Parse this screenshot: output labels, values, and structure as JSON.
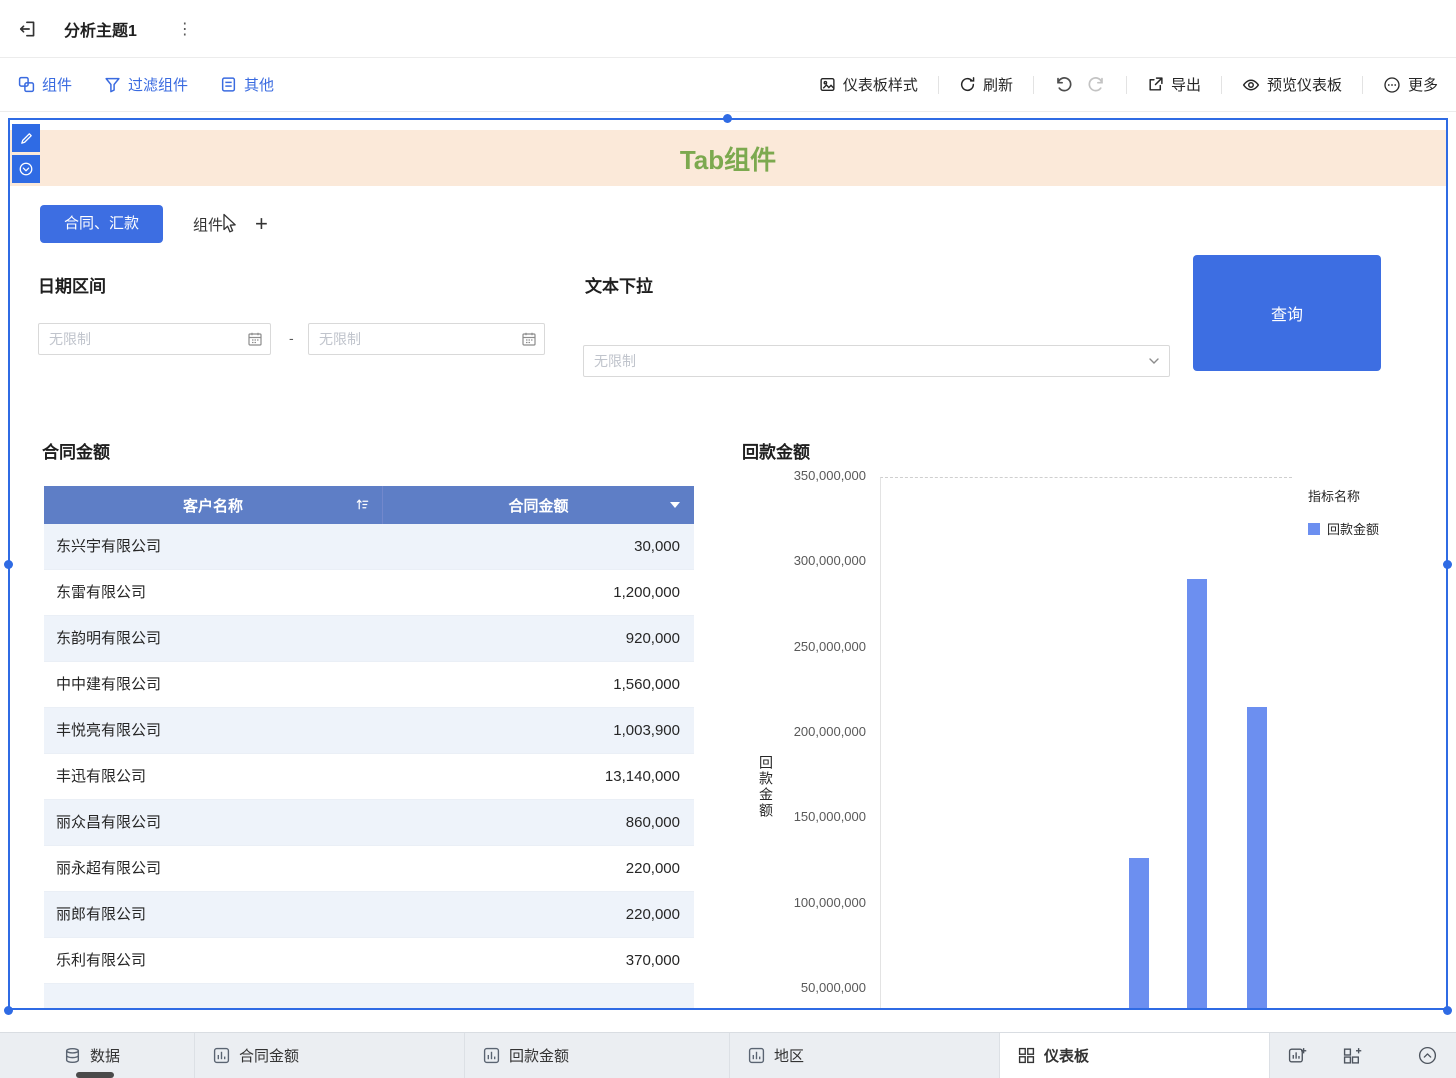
{
  "header": {
    "title": "分析主题1",
    "menu_dots": "⋮"
  },
  "toolbar": {
    "components": "组件",
    "filter_components": "过滤组件",
    "others": "其他",
    "dashboard_style": "仪表板样式",
    "refresh": "刷新",
    "export": "导出",
    "preview": "预览仪表板",
    "more": "更多"
  },
  "canvas": {
    "banner_title": "Tab组件",
    "tabs": {
      "active": "合同、汇款",
      "second": "组件",
      "add": "+"
    },
    "filters": {
      "date_label": "日期区间",
      "date_from_placeholder": "无限制",
      "date_to_placeholder": "无限制",
      "range_separator": "-",
      "select_label": "文本下拉",
      "select_placeholder": "无限制",
      "query_button": "查询"
    },
    "table": {
      "title": "合同金额",
      "columns": [
        "客户名称",
        "合同金额"
      ],
      "rows": [
        [
          "东兴宇有限公司",
          "30,000"
        ],
        [
          "东雷有限公司",
          "1,200,000"
        ],
        [
          "东韵明有限公司",
          "920,000"
        ],
        [
          "中中建有限公司",
          "1,560,000"
        ],
        [
          "丰悦亮有限公司",
          "1,003,900"
        ],
        [
          "丰迅有限公司",
          "13,140,000"
        ],
        [
          "丽众昌有限公司",
          "860,000"
        ],
        [
          "丽永超有限公司",
          "220,000"
        ],
        [
          "丽郎有限公司",
          "220,000"
        ],
        [
          "乐利有限公司",
          "370,000"
        ]
      ]
    },
    "chart": {
      "title": "回款金额",
      "legend_title": "指标名称",
      "legend_item": "回款金额",
      "y_axis_title": "回款金额"
    }
  },
  "chart_data": {
    "type": "bar",
    "title": "回款金额",
    "ylabel": "回款金额",
    "series": [
      {
        "name": "回款金额",
        "color": "#6C8FF0",
        "values": [
          127000000,
          291000000,
          216000000
        ]
      }
    ],
    "y_tick_labels": [
      "350,000,000",
      "300,000,000",
      "250,000,000",
      "200,000,000",
      "150,000,000",
      "100,000,000",
      "50,000,000"
    ],
    "ylim": [
      0,
      350000000
    ],
    "grid": "top-dashed-only",
    "legend_position": "right",
    "x_axis": "clipped-below-visible-area"
  },
  "bottom_bar": {
    "tabs": [
      {
        "label": "数据",
        "icon": "database-icon",
        "active": false
      },
      {
        "label": "合同金额",
        "icon": "chart-icon",
        "active": false
      },
      {
        "label": "回款金额",
        "icon": "chart-icon",
        "active": false
      },
      {
        "label": "地区",
        "icon": "chart-icon",
        "active": false
      },
      {
        "label": "仪表板",
        "icon": "dashboard-icon",
        "active": true
      }
    ]
  },
  "colors": {
    "accent": "#3D6EE2",
    "selection": "#2F6BE4",
    "table_header": "#5E7EC6",
    "bar": "#6C8FF0",
    "banner_bg": "#FBE9D9",
    "banner_text": "#7CA94F"
  }
}
